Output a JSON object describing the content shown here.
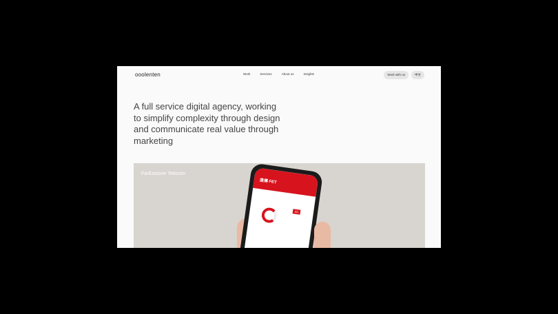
{
  "header": {
    "logo": "ooolenten",
    "nav": [
      "Work",
      "Services",
      "About us",
      "Insights"
    ],
    "cta": "Work with us",
    "lang": "中文"
  },
  "hero": {
    "headline": "A full service digital agency, working to simplify complexity through design and communicate real value through marketing"
  },
  "feature": {
    "client": "FarEastone Telecom",
    "app_name": "遠傳 FET",
    "badge": "5G",
    "accent": "#d7131e"
  }
}
